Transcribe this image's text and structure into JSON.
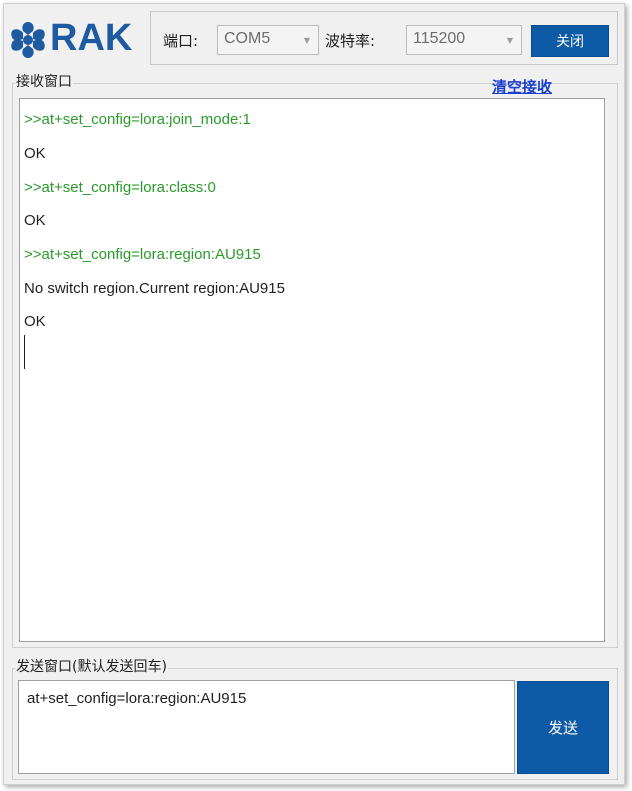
{
  "brand": {
    "logo_text": "RAK",
    "color": "#1e5aa0"
  },
  "config": {
    "port_label": "端口:",
    "port_value": "COM5",
    "baud_label": "波特率:",
    "baud_value": "115200",
    "close_label": "关闭"
  },
  "receive": {
    "legend": "接收窗口",
    "clear_label": "清空接收",
    "lines": [
      {
        "text": ">>at+set_config=lora:join_mode:1",
        "kind": "command"
      },
      {
        "text": "OK",
        "kind": "response"
      },
      {
        "text": ">>at+set_config=lora:class:0",
        "kind": "command"
      },
      {
        "text": "OK",
        "kind": "response"
      },
      {
        "text": ">>at+set_config=lora:region:AU915",
        "kind": "command"
      },
      {
        "text": "No switch region.Current region:AU915",
        "kind": "response"
      },
      {
        "text": "OK",
        "kind": "response"
      }
    ]
  },
  "send": {
    "legend": "发送窗口(默认发送回车)",
    "input_value": "at+set_config=lora:region:AU915",
    "send_label": "发送"
  },
  "colors": {
    "accent": "#0d5aa7",
    "command_text": "#2a9a2a",
    "link": "#1a3fd0"
  },
  "icons": {
    "logo": "rak-hexagon-logo-icon",
    "dropdown": "chevron-down-icon"
  }
}
